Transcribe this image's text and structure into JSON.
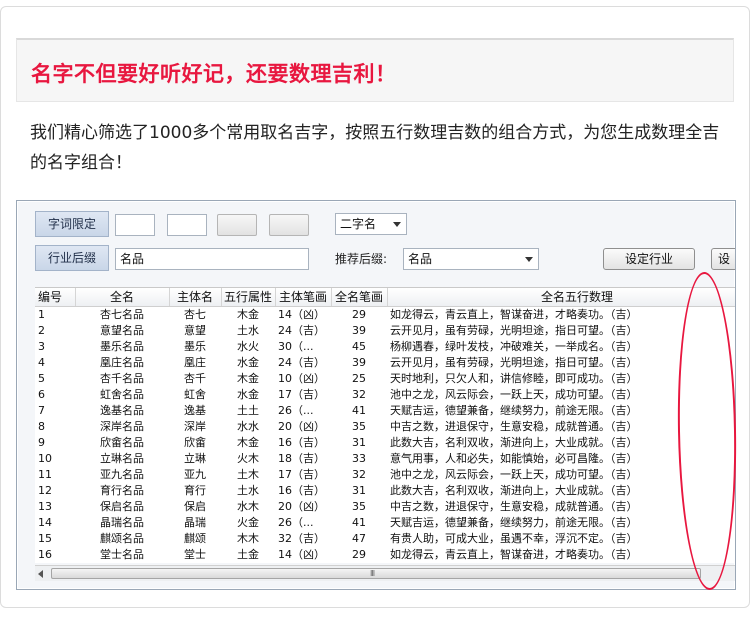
{
  "banner": {
    "title": "名字不但要好听好记，还要数理吉利！"
  },
  "intro": {
    "text": "我们精心筛选了1000多个常用取名吉字，按照五行数理吉数的组合方式，为您生成数理全吉的名字组合！"
  },
  "toolbar": {
    "char_limit_label": "字词限定",
    "industry_suffix_label": "行业后缀",
    "industry_suffix_value": "名品",
    "name_length_select": "二字名",
    "recommended_suffix_label": "推荐后缀:",
    "recommended_suffix_value": "名品",
    "set_industry_button": "设定行业",
    "cut_button": "设"
  },
  "table": {
    "columns": [
      "编号",
      "全名",
      "主体名",
      "五行属性",
      "主体笔画",
      "全名笔画",
      "全名五行数理"
    ],
    "rows": [
      [
        "1",
        "杏七名品",
        "杏七",
        "木金",
        "14（凶）",
        "29",
        "如龙得云，青云直上，智谋奋进，才略奏功。（吉）"
      ],
      [
        "2",
        "意望名品",
        "意望",
        "土水",
        "24（吉）",
        "39",
        "云开见月，虽有劳碌，光明坦途，指日可望。（吉）"
      ],
      [
        "3",
        "墨乐名品",
        "墨乐",
        "水火",
        "30（...",
        "45",
        "杨柳遇春，绿叶发枝，冲破难关，一举成名。（吉）"
      ],
      [
        "4",
        "凰庄名品",
        "凰庄",
        "水金",
        "24（吉）",
        "39",
        "云开见月，虽有劳碌，光明坦途，指日可望。（吉）"
      ],
      [
        "5",
        "杏千名品",
        "杏千",
        "木金",
        "10（凶）",
        "25",
        "天时地利，只欠人和，讲信修睦，即可成功。（吉）"
      ],
      [
        "6",
        "虹舍名品",
        "虹舍",
        "水金",
        "17（吉）",
        "32",
        "池中之龙，风云际会，一跃上天，成功可望。（吉）"
      ],
      [
        "7",
        "逸基名品",
        "逸基",
        "土土",
        "26（...",
        "41",
        "天赋吉运，德望兼备，继续努力，前途无限。（吉）"
      ],
      [
        "8",
        "深岸名品",
        "深岸",
        "水水",
        "20（凶）",
        "35",
        "中吉之数，进退保守，生意安稳，成就普通。（吉）"
      ],
      [
        "9",
        "欣畲名品",
        "欣畲",
        "木金",
        "16（吉）",
        "31",
        "此数大吉，名利双收，渐进向上，大业成就。（吉）"
      ],
      [
        "10",
        "立琳名品",
        "立琳",
        "火木",
        "18（吉）",
        "33",
        "意气用事，人和必失，如能慎始，必可昌隆。（吉）"
      ],
      [
        "11",
        "亚九名品",
        "亚九",
        "土木",
        "17（吉）",
        "32",
        "池中之龙，风云际会，一跃上天，成功可望。（吉）"
      ],
      [
        "12",
        "育行名品",
        "育行",
        "土水",
        "16（吉）",
        "31",
        "此数大吉，名利双收，渐进向上，大业成就。（吉）"
      ],
      [
        "13",
        "保启名品",
        "保启",
        "水木",
        "20（凶）",
        "35",
        "中吉之数，进退保守，生意安稳，成就普通。（吉）"
      ],
      [
        "14",
        "晶瑞名品",
        "晶瑞",
        "火金",
        "26（...",
        "41",
        "天赋吉运，德望兼备，继续努力，前途无限。（吉）"
      ],
      [
        "15",
        "麒颂名品",
        "麒颂",
        "木木",
        "32（吉）",
        "47",
        "有贵人助，可成大业，虽遇不幸，浮沉不定。（吉）"
      ],
      [
        "16",
        "堂士名品",
        "堂士",
        "土金",
        "14（凶）",
        "29",
        "如龙得云，青云直上，智谋奋进，才略奏功。（吉）"
      ]
    ]
  },
  "scrollbar": {
    "grip": "III"
  },
  "colors": {
    "accent_red": "#e8173f",
    "label_bg": "#c9d6e8"
  }
}
